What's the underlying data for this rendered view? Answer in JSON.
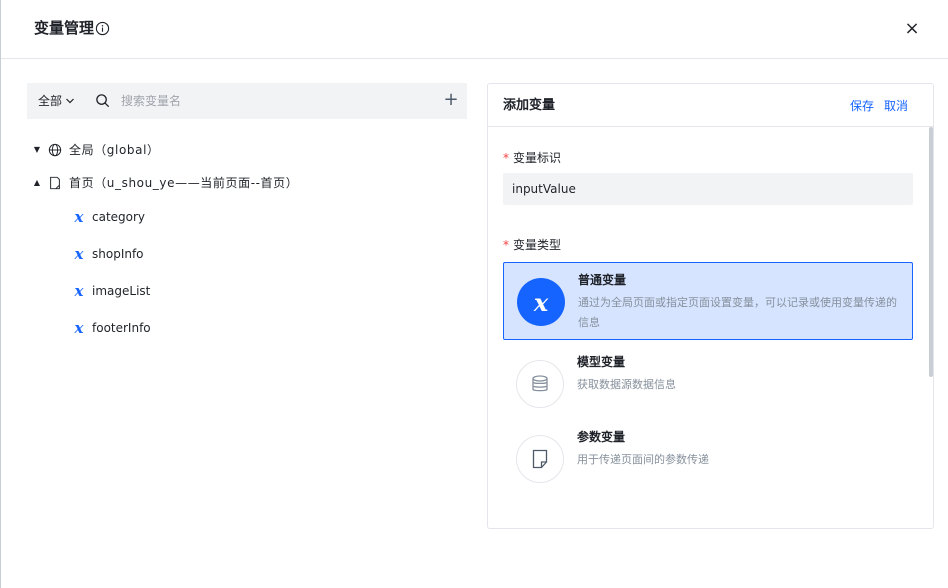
{
  "dialog": {
    "title": "变量管理",
    "close_label": "×"
  },
  "search": {
    "scope_label": "全部",
    "placeholder": "搜索变量名",
    "add_label": "+"
  },
  "tree": {
    "nodes": [
      {
        "label": "全局（global）",
        "caret": "▼",
        "icon": "globe-icon"
      },
      {
        "label": "首页（u_shou_ye——当前页面--首页）",
        "caret": "▲",
        "icon": "page-icon"
      }
    ],
    "variables": [
      "category",
      "shopInfo",
      "imageList",
      "footerInfo"
    ],
    "variable_icon_glyph": "x"
  },
  "form": {
    "title": "添加变量",
    "save_label": "保存",
    "cancel_label": "取消",
    "id_label": "变量标识",
    "id_value": "inputValue",
    "type_label": "变量类型",
    "required_mark": "*",
    "types": [
      {
        "name": "普通变量",
        "desc": "通过为全局页面或指定页面设置变量，可以记录或使用变量传递的信息",
        "selected": true,
        "icon": "variable-x-icon"
      },
      {
        "name": "模型变量",
        "desc": "获取数据源数据信息",
        "selected": false,
        "icon": "database-icon"
      },
      {
        "name": "参数变量",
        "desc": "用于传递页面间的参数传递",
        "selected": false,
        "icon": "document-icon"
      }
    ]
  },
  "colors": {
    "accent": "#1664ff",
    "selected_bg": "#d6e4ff",
    "required": "#f53f3f",
    "muted": "#86909c"
  }
}
